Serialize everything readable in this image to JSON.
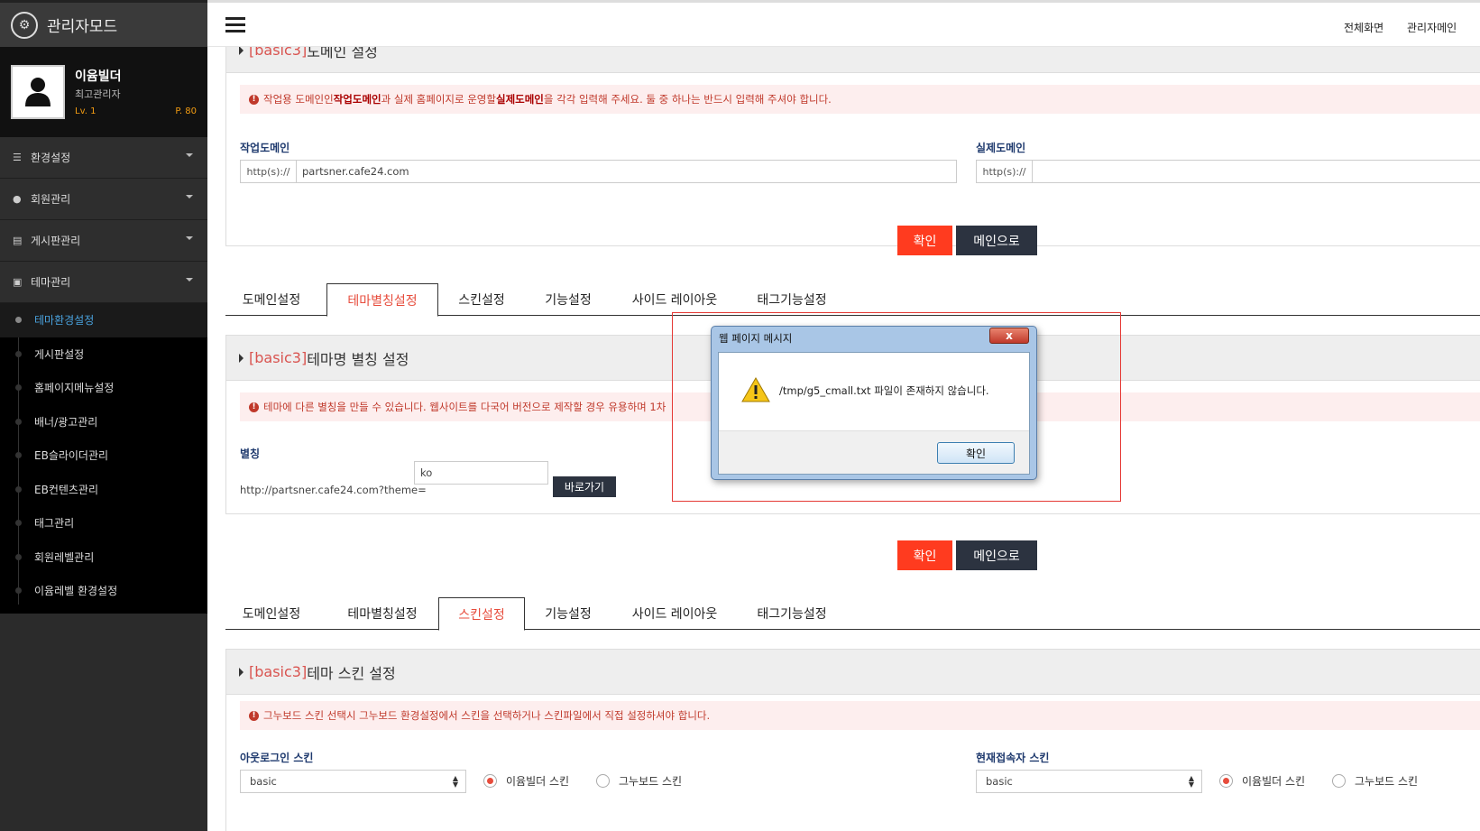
{
  "sidebar": {
    "title": "관리자모드",
    "profile": {
      "name": "이윰빌더",
      "role": "최고관리자",
      "level_label": "Lv.",
      "level": "1",
      "point_label": "P.",
      "point": "80"
    },
    "menus": [
      {
        "label": "환경설정",
        "icon": "sliders-icon"
      },
      {
        "label": "회원관리",
        "icon": "user-icon"
      },
      {
        "label": "게시판관리",
        "icon": "board-icon"
      },
      {
        "label": "테마관리",
        "icon": "puzzle-icon"
      }
    ],
    "submenu": [
      {
        "label": "테마환경설정",
        "active": true
      },
      {
        "label": "게시판설정"
      },
      {
        "label": "홈페이지메뉴설정"
      },
      {
        "label": "배너/광고관리"
      },
      {
        "label": "EB슬라이더관리"
      },
      {
        "label": "EB컨텐츠관리"
      },
      {
        "label": "태그관리"
      },
      {
        "label": "회원레벨관리"
      },
      {
        "label": "이윰레벨 환경설정"
      }
    ]
  },
  "topbar": {
    "links": [
      "전체화면",
      "관리자메인"
    ]
  },
  "domain_section": {
    "tag": "[basic3]",
    "title": " 도메인 설정",
    "alert": {
      "pre": "작업용 도메인인 ",
      "b1": "작업도메인",
      "mid": "과 실제 홈페이지로 운영할 ",
      "b2": "실제도메인",
      "post": "을 각각 입력해 주세요. 둘 중 하나는 반드시 입력해 주셔야 합니다."
    },
    "work_label": "작업도메인",
    "work_prefix": "http(s)://",
    "work_value": "partsner.cafe24.com",
    "real_label": "실제도메인",
    "real_prefix": "http(s)://",
    "real_value": ""
  },
  "buttons": {
    "confirm": "확인",
    "to_main": "메인으로"
  },
  "tabs": [
    "도메인설정",
    "테마별칭설정",
    "스킨설정",
    "기능설정",
    "사이드 레이아웃",
    "태그기능설정"
  ],
  "alias_section": {
    "tag": "[basic3]",
    "title": " 테마명 별칭 설정",
    "alert": "테마에 다른 별칭을 만들 수 있습니다. 웹사이트를 다국어 버전으로 제작할 경우 유용하며 1차",
    "label": "별칭",
    "url_prefix": "http://partsner.cafe24.com?theme=",
    "input_value": "ko",
    "go_button": "바로가기"
  },
  "skin_section": {
    "tag": "[basic3]",
    "title": " 테마 스킨 설정",
    "alert": "그누보드 스킨 선택시 그누보드 환경설정에서 스킨을 선택하거나 스킨파일에서 직접 설정하셔야 합니다.",
    "outlogin_label": "아웃로그인 스킨",
    "outlogin_value": "basic",
    "connect_label": "현재접속자 스킨",
    "connect_value": "basic",
    "radio_eyoom": "이윰빌더 스킨",
    "radio_gnu": "그누보드 스킨"
  },
  "dialog": {
    "title": "웹 페이지 메시지",
    "close": "x",
    "message": "/tmp/g5_cmall.txt 파일이 존재하지 않습니다.",
    "ok": "확인"
  },
  "colors": {
    "accent_red": "#ff3b1f",
    "tag_red": "#d9534f",
    "dark_button": "#2c3340",
    "active_sub": "#4aa3df"
  }
}
